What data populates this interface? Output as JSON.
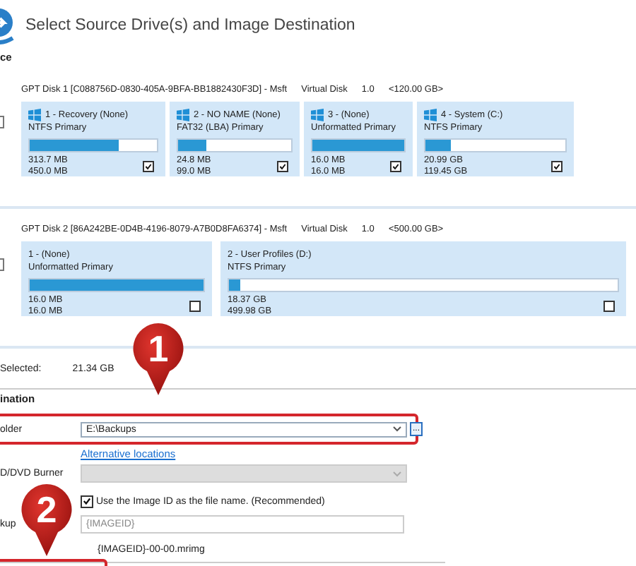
{
  "header": {
    "title": "Select Source Drive(s) and Image Destination",
    "section_label": "ce"
  },
  "disks": [
    {
      "name": "GPT Disk 1 [C088756D-0830-405A-9BFA-BB1882430F3D] - Msft",
      "type": "Virtual Disk",
      "version": "1.0",
      "size": "<120.00 GB>",
      "checked": false,
      "partitions": [
        {
          "name": "1 - Recovery (None)",
          "fs": "NTFS Primary",
          "level": 0.7,
          "used": "313.7 MB",
          "total": "450.0 MB",
          "checked": true,
          "os_icon": true
        },
        {
          "name": "2 - NO NAME (None)",
          "fs": "FAT32 (LBA) Primary",
          "level": 0.25,
          "used": "24.8 MB",
          "total": "99.0 MB",
          "checked": true,
          "os_icon": true
        },
        {
          "name": "3 -  (None)",
          "fs": "Unformatted Primary",
          "level": 1,
          "used": "16.0 MB",
          "total": "16.0 MB",
          "checked": true,
          "os_icon": true
        },
        {
          "name": "4 - System (C:)",
          "fs": "NTFS Primary",
          "level": 0.18,
          "used": "20.99 GB",
          "total": "119.45 GB",
          "checked": true,
          "os_icon": true
        }
      ]
    },
    {
      "name": "GPT Disk 2 [86A242BE-0D4B-4196-8079-A7B0D8FA6374] - Msft",
      "type": "Virtual Disk",
      "version": "1.0",
      "size": "<500.00 GB>",
      "checked": false,
      "partitions": [
        {
          "name": "1 -  (None)",
          "fs": "Unformatted Primary",
          "level": 1,
          "used": "16.0 MB",
          "total": "16.0 MB",
          "checked": false,
          "os_icon": false
        },
        {
          "name": "2 - User Profiles (D:)",
          "fs": "NTFS Primary",
          "level": 0.03,
          "used": "18.37 GB",
          "total": "499.98 GB",
          "checked": false,
          "os_icon": false
        }
      ]
    }
  ],
  "selected": {
    "label": "Selected:",
    "value": "21.34 GB"
  },
  "destination": {
    "section_label": "ination",
    "folder_label": "older",
    "folder_value": "E:\\Backups",
    "browse": "...",
    "alt_link": "Alternative locations",
    "burner_label": "D/DVD Burner",
    "burner_disabled": true,
    "use_id": {
      "label": "Use the Image ID as the file name.  (Recommended)",
      "checked": true
    },
    "filename_label": "kup",
    "filename_placeholder": "{IMAGEID}",
    "filename_preview": "{IMAGEID}-00-00.mrimg"
  },
  "callouts": [
    {
      "number": "1"
    },
    {
      "number": "2"
    }
  ]
}
